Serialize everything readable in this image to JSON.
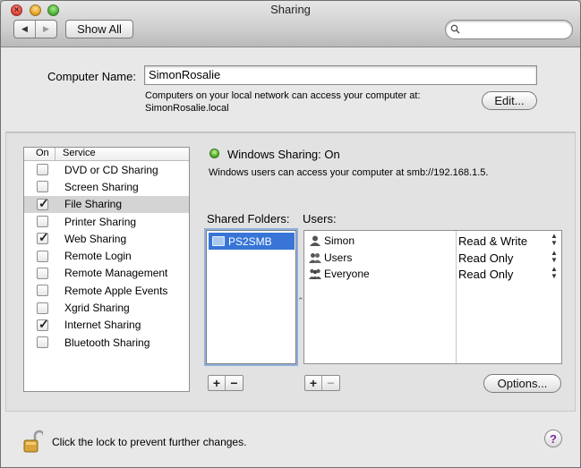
{
  "window": {
    "title": "Sharing"
  },
  "toolbar": {
    "show_all_label": "Show All"
  },
  "computer": {
    "name_label": "Computer Name:",
    "name_value": "SimonRosalie",
    "description_line1": "Computers on your local network can access your computer at:",
    "description_line2": "SimonRosalie.local",
    "edit_label": "Edit..."
  },
  "services": {
    "header_on": "On",
    "header_service": "Service",
    "items": [
      {
        "label": "DVD or CD Sharing",
        "checked": false,
        "selected": false
      },
      {
        "label": "Screen Sharing",
        "checked": false,
        "selected": false
      },
      {
        "label": "File Sharing",
        "checked": true,
        "selected": true
      },
      {
        "label": "Printer Sharing",
        "checked": false,
        "selected": false
      },
      {
        "label": "Web Sharing",
        "checked": true,
        "selected": false
      },
      {
        "label": "Remote Login",
        "checked": false,
        "selected": false
      },
      {
        "label": "Remote Management",
        "checked": false,
        "selected": false
      },
      {
        "label": "Remote Apple Events",
        "checked": false,
        "selected": false
      },
      {
        "label": "Xgrid Sharing",
        "checked": false,
        "selected": false
      },
      {
        "label": "Internet Sharing",
        "checked": true,
        "selected": false
      },
      {
        "label": "Bluetooth Sharing",
        "checked": false,
        "selected": false
      }
    ]
  },
  "status": {
    "text": "Windows Sharing: On",
    "description": "Windows users can access your computer at smb://192.168.1.5.",
    "color": "#4da824"
  },
  "shared_folders": {
    "label": "Shared Folders:",
    "items": [
      {
        "name": "PS2SMB"
      }
    ],
    "add_label": "+",
    "remove_label": "−"
  },
  "users": {
    "label": "Users:",
    "items": [
      {
        "name": "Simon",
        "permission": "Read & Write",
        "icon": "single-user-icon"
      },
      {
        "name": "Users",
        "permission": "Read Only",
        "icon": "group-icon"
      },
      {
        "name": "Everyone",
        "permission": "Read Only",
        "icon": "everyone-icon"
      }
    ],
    "add_label": "+",
    "remove_label": "−",
    "options_label": "Options..."
  },
  "footer": {
    "lock_text": "Click the lock to prevent further changes.",
    "help_label": "?"
  }
}
